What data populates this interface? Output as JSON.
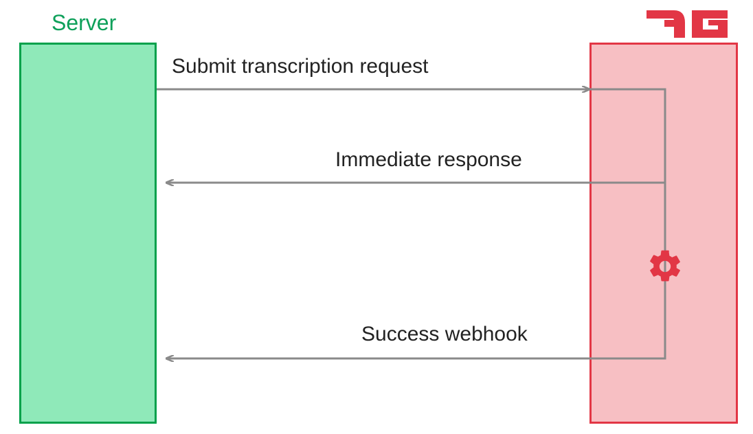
{
  "left": {
    "label": "Server"
  },
  "right": {
    "logo": "DG"
  },
  "arrows": {
    "request": "Submit transcription request",
    "immediate": "Immediate response",
    "success": "Success webhook"
  },
  "icons": {
    "process": "gear-icon"
  },
  "colors": {
    "serverBorder": "#00a14b",
    "serverFill": "#8fe9b9",
    "dgBorder": "#e23645",
    "dgFill": "#f7bfc3",
    "arrow": "#8a8a8a"
  }
}
